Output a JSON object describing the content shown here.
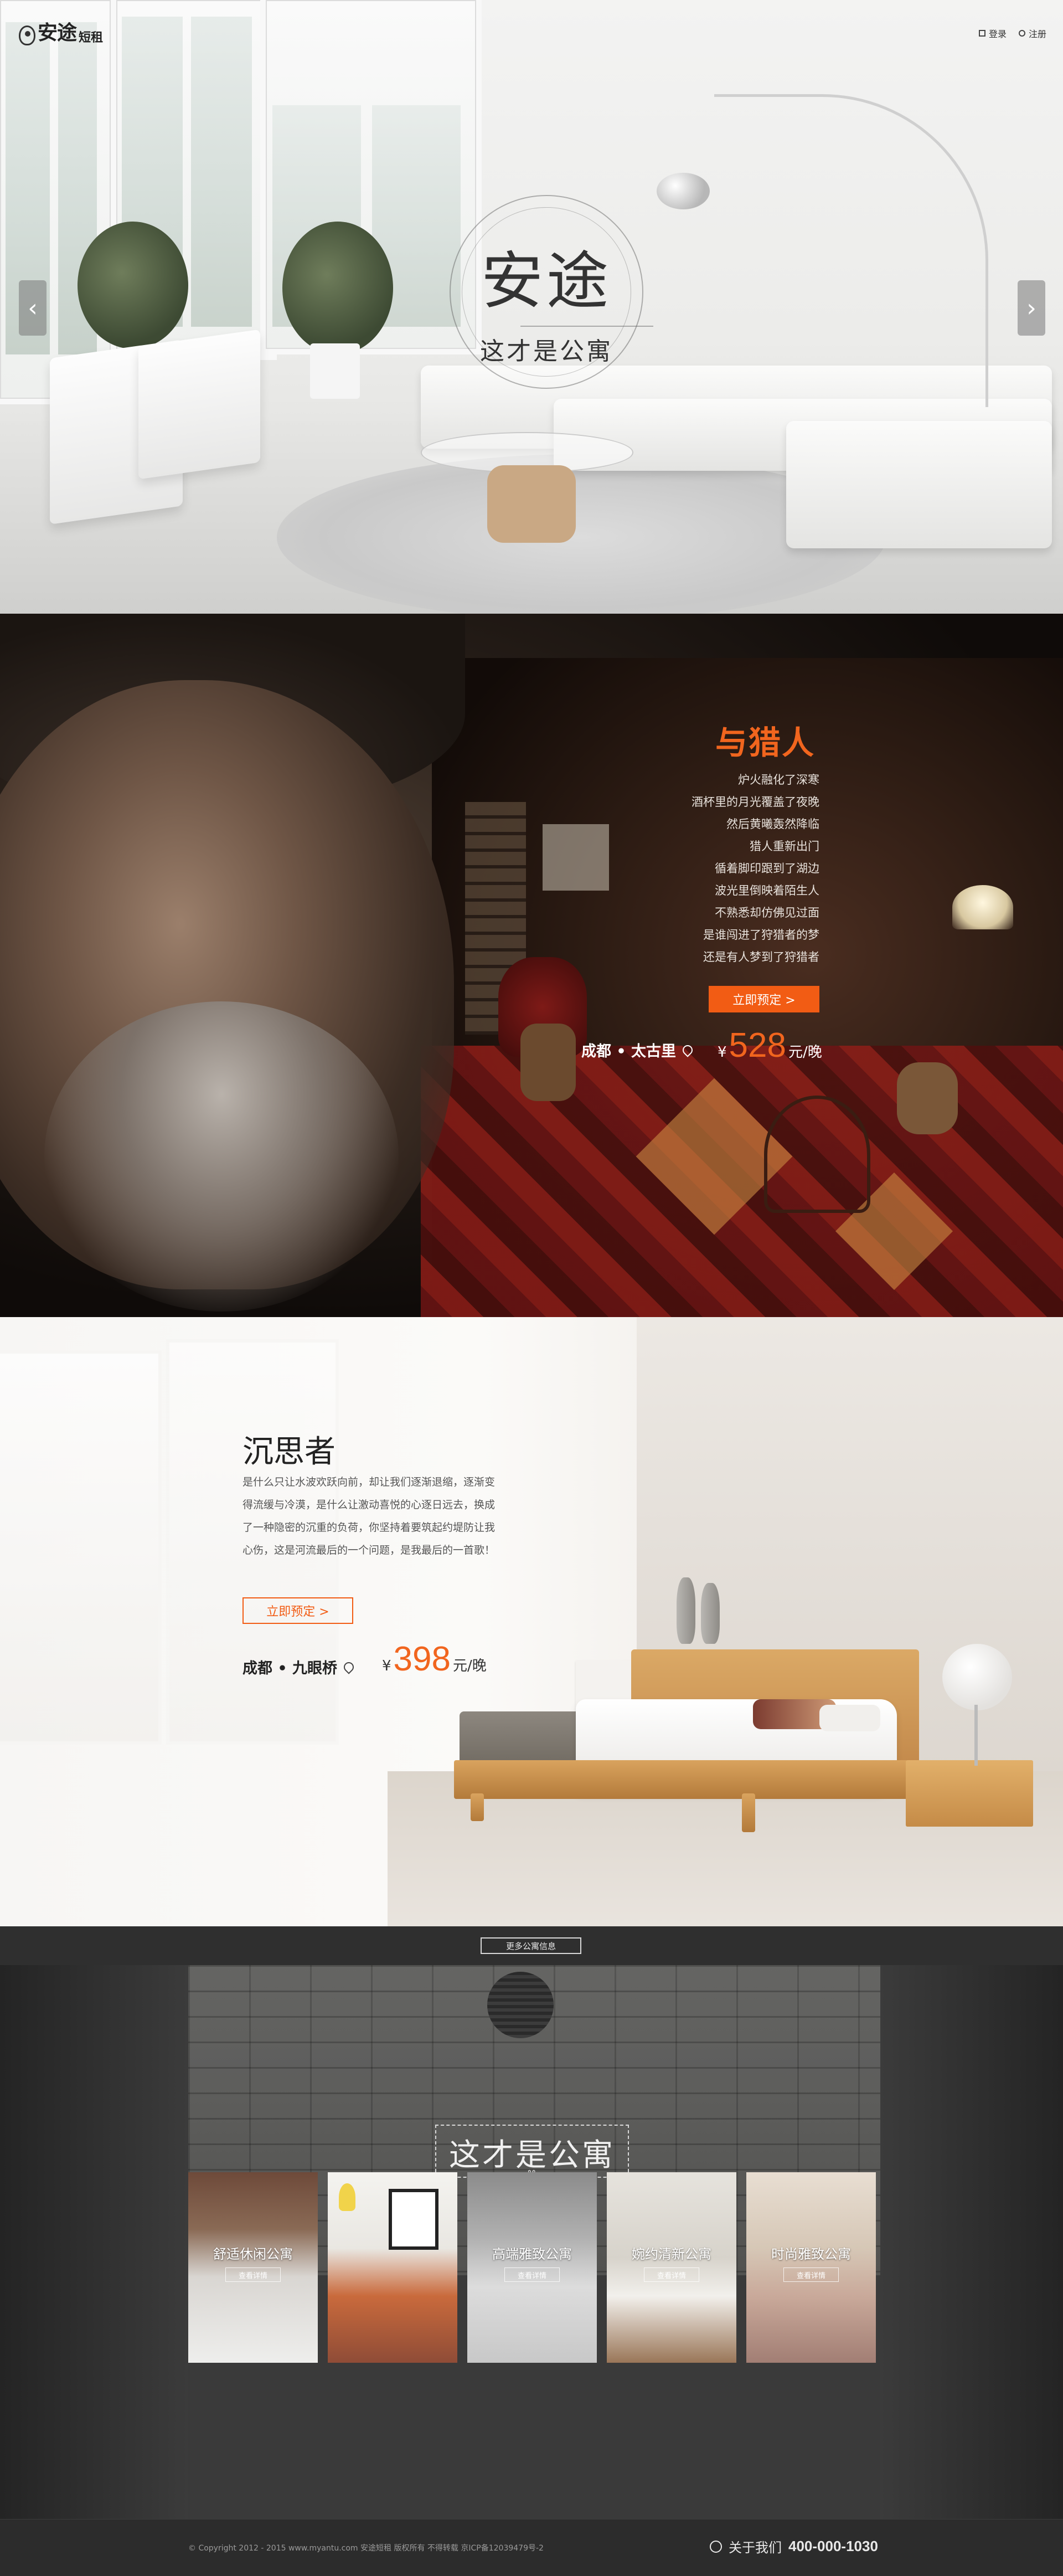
{
  "brand": {
    "name": "安途",
    "suffix": "短租"
  },
  "topnav": {
    "login": "登录",
    "register": "注册"
  },
  "hero": {
    "title": "安途",
    "subtitle": "这才是公寓",
    "prev_arrow": "‹",
    "next_arrow": "›"
  },
  "hunter": {
    "title": "与猎人",
    "poem": [
      "炉火融化了深寒",
      "酒杯里的月光覆盖了夜晚",
      "然后黄曦轰然降临",
      "猎人重新出门",
      "循着脚印跟到了湖边",
      "波光里倒映着陌生人",
      "不熟悉却仿佛见过面",
      "是谁闯进了狩猎者的梦",
      "还是有人梦到了狩猎者"
    ],
    "book_label": "立即预定 >",
    "location": "成都 • 太古里",
    "currency": "¥",
    "price": "528",
    "unit": "元/晚"
  },
  "thinker": {
    "title": "沉思者",
    "description": "是什么只让水波欢跃向前，却让我们逐渐退缩，逐渐变得流缓与冷漠，是什么让激动喜悦的心逐日远去，换成了一种隐密的沉重的负荷，你坚持着要筑起约堤防让我心伤，这是河流最后的一个问题，是我最后的一首歌！",
    "book_label": "立即预定 >",
    "location": "成都 • 九眼桥",
    "currency": "¥",
    "price": "398",
    "unit": "元/晚"
  },
  "more": {
    "button": "更多公寓信息",
    "title": "这才是公寓",
    "cards": [
      {
        "label": "舒适休闲公寓",
        "button": "查看详情",
        "active": false
      },
      {
        "label": "",
        "button": "",
        "active": true
      },
      {
        "label": "高端雅致公寓",
        "button": "查看详情",
        "active": false
      },
      {
        "label": "婉约清新公寓",
        "button": "查看详情",
        "active": false
      },
      {
        "label": "时尚雅致公寓",
        "button": "查看详情",
        "active": false
      }
    ]
  },
  "footer": {
    "copyright": "© Copyright 2012 - 2015 www.myantu.com 安途短租 版权所有 不得转载 京ICP备12039479号-2",
    "about": "关于我们",
    "phone": "400-000-1030"
  },
  "colors": {
    "accent": "#f25c14",
    "dark": "#2c2c2c"
  }
}
